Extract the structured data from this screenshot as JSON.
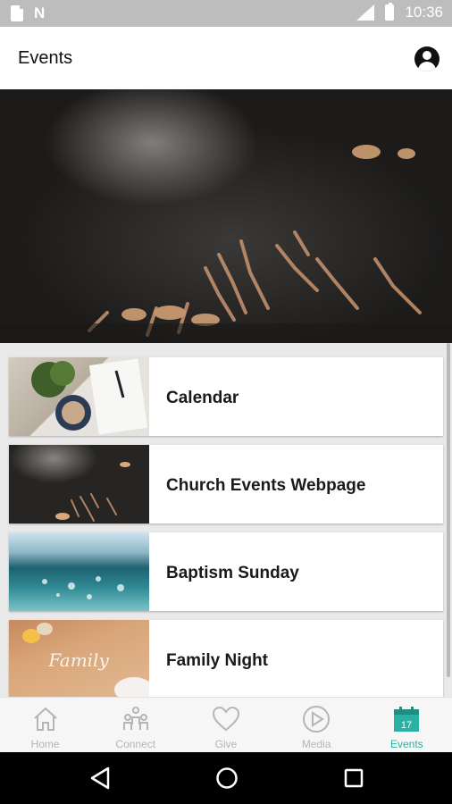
{
  "status_bar": {
    "time": "10:36"
  },
  "app_bar": {
    "title": "Events"
  },
  "events": [
    {
      "label": "Calendar"
    },
    {
      "label": "Church Events Webpage"
    },
    {
      "label": "Baptism Sunday"
    },
    {
      "label": "Family Night"
    }
  ],
  "thumb_text": {
    "family": "Family"
  },
  "bottom_nav": {
    "items": [
      {
        "label": "Home",
        "icon": "home-icon"
      },
      {
        "label": "Connect",
        "icon": "connect-icon"
      },
      {
        "label": "Give",
        "icon": "heart-icon"
      },
      {
        "label": "Media",
        "icon": "play-icon"
      },
      {
        "label": "Events",
        "icon": "calendar-icon",
        "active": true,
        "badge": "17"
      }
    ]
  },
  "colors": {
    "accent": "#2bb0a4",
    "inactive": "#b5b5b5"
  }
}
